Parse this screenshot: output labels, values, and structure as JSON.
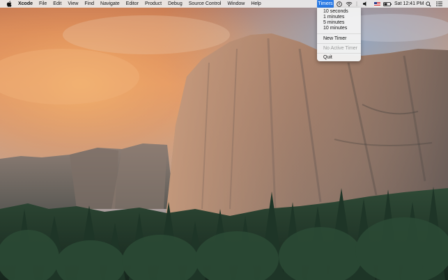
{
  "menubar": {
    "app_name": "Xcode",
    "menus": [
      "File",
      "Edit",
      "View",
      "Find",
      "Navigate",
      "Editor",
      "Product",
      "Debug",
      "Source Control",
      "Window",
      "Help"
    ],
    "timers_label": "Timers",
    "clock": "Sat 12:41 PM"
  },
  "dropdown": {
    "durations": [
      "10 seconds",
      "1 minutes",
      "5 minutes",
      "10 minutes"
    ],
    "new_timer": "New Timer",
    "no_active_timer": "No Active Timer",
    "quit": "Quit"
  },
  "colors": {
    "menu_highlight": "#2b7be6",
    "disabled_text": "#9b9b9b"
  },
  "icons": [
    "apple-icon",
    "timer-status-icon",
    "wifi-icon",
    "volume-icon",
    "us-flag-icon",
    "battery-icon",
    "spotlight-search-icon",
    "notification-center-icon"
  ]
}
